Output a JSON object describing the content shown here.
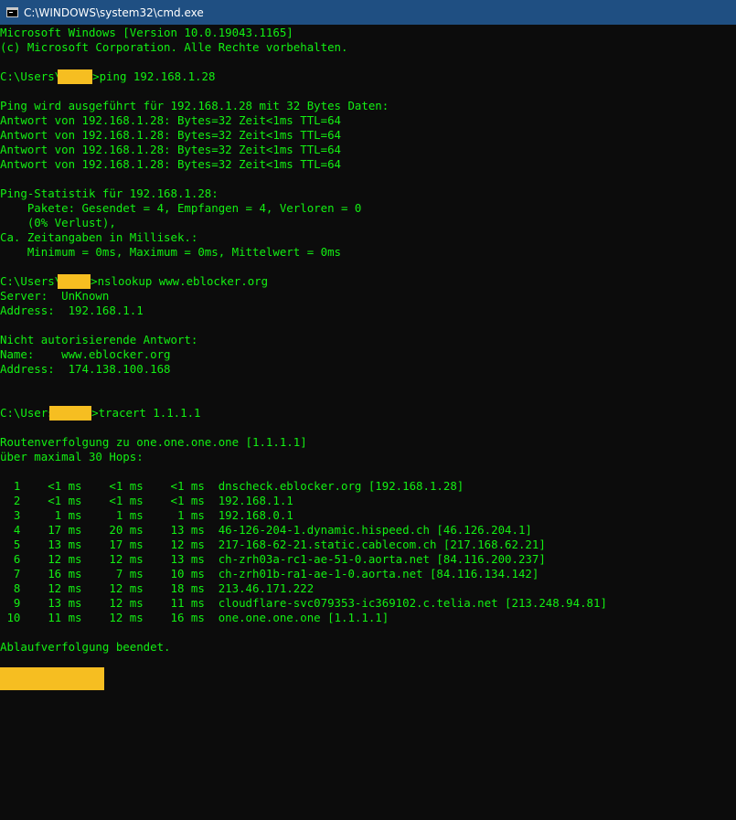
{
  "window": {
    "title": "C:\\WINDOWS\\system32\\cmd.exe"
  },
  "colors": {
    "text": "#13f013",
    "background": "#0c0c0c",
    "titlebar": "#1f4f82",
    "redaction": "#f6be21"
  },
  "console": {
    "header": [
      "Microsoft Windows [Version 10.0.19043.1165]",
      "(c) Microsoft Corporation. Alle Rechte vorbehalten."
    ],
    "prompt_prefix": "C:\\Users\\",
    "ping_command": ">ping 192.168.1.28",
    "ping_output": [
      "Ping wird ausgeführt für 192.168.1.28 mit 32 Bytes Daten:",
      "Antwort von 192.168.1.28: Bytes=32 Zeit<1ms TTL=64",
      "Antwort von 192.168.1.28: Bytes=32 Zeit<1ms TTL=64",
      "Antwort von 192.168.1.28: Bytes=32 Zeit<1ms TTL=64",
      "Antwort von 192.168.1.28: Bytes=32 Zeit<1ms TTL=64"
    ],
    "ping_stats": [
      "Ping-Statistik für 192.168.1.28:",
      "    Pakete: Gesendet = 4, Empfangen = 4, Verloren = 0",
      "    (0% Verlust),",
      "Ca. Zeitangaben in Millisek.:",
      "    Minimum = 0ms, Maximum = 0ms, Mittelwert = 0ms"
    ],
    "nslookup_command": ">nslookup www.eblocker.org",
    "nslookup_server": [
      "Server:  UnKnown",
      "Address:  192.168.1.1"
    ],
    "nslookup_answer": [
      "Nicht autorisierende Antwort:",
      "Name:    www.eblocker.org",
      "Address:  174.138.100.168"
    ],
    "tracert_command": ">tracert 1.1.1.1",
    "tracert_header": [
      "Routenverfolgung zu one.one.one.one [1.1.1.1]",
      "über maximal 30 Hops:"
    ],
    "hops": [
      "  1    <1 ms    <1 ms    <1 ms  dnscheck.eblocker.org [192.168.1.28]",
      "  2    <1 ms    <1 ms    <1 ms  192.168.1.1",
      "  3     1 ms     1 ms     1 ms  192.168.0.1",
      "  4    17 ms    20 ms    13 ms  46-126-204-1.dynamic.hispeed.ch [46.126.204.1]",
      "  5    13 ms    17 ms    12 ms  217-168-62-21.static.cablecom.ch [217.168.62.21]",
      "  6    12 ms    12 ms    13 ms  ch-zrh03a-rc1-ae-51-0.aorta.net [84.116.200.237]",
      "  7    16 ms     7 ms    10 ms  ch-zrh01b-ra1-ae-1-0.aorta.net [84.116.134.142]",
      "  8    12 ms    12 ms    18 ms  213.46.171.222",
      "  9    13 ms    12 ms    11 ms  cloudflare-svc079353-ic369102.c.telia.net [213.248.94.81]",
      " 10    11 ms    12 ms    16 ms  one.one.one.one [1.1.1.1]"
    ],
    "tracert_done": "Ablaufverfolgung beendet."
  }
}
